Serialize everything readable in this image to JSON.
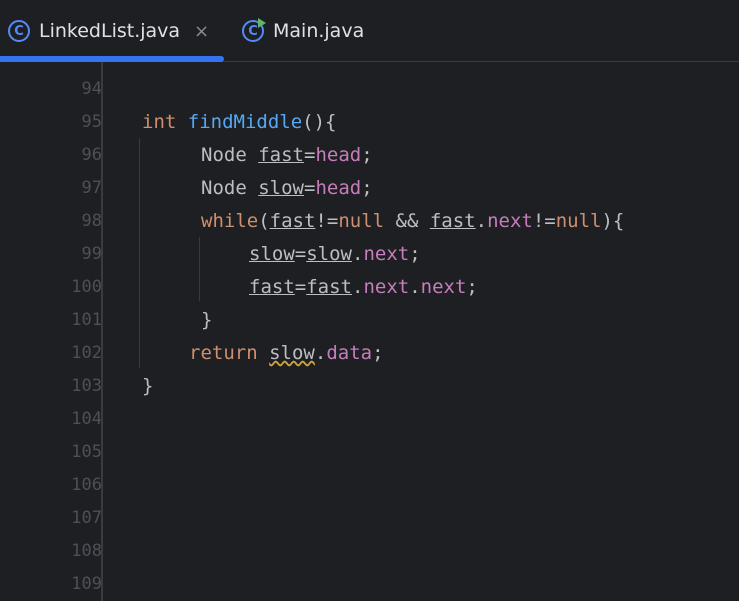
{
  "tabs": [
    {
      "label": "LinkedList.java",
      "icon": "class-icon",
      "icon_glyph": "C",
      "active": true,
      "close": "×"
    },
    {
      "label": "Main.java",
      "icon": "main-class-icon",
      "icon_glyph": "C",
      "active": false
    }
  ],
  "colors": {
    "background": "#1e1f22",
    "accent": "#3574f0",
    "keyword": "#cf8e6d",
    "function": "#56a8f5",
    "field": "#c77dbb",
    "text": "#bcbec4",
    "line_number": "#4b5059",
    "warning": "#d1a23c"
  },
  "editor": {
    "line_numbers": [
      "94",
      "95",
      "96",
      "97",
      "98",
      "99",
      "100",
      "101",
      "102",
      "103",
      "104",
      "105",
      "106",
      "107",
      "108",
      "109"
    ],
    "code": {
      "l95": {
        "kw": "int",
        "fn": "findMiddle",
        "rest": "(){"
      },
      "l96": {
        "type": "Node",
        "var": "fast",
        "eq": "=",
        "field": "head",
        "semi": ";"
      },
      "l97": {
        "type": "Node",
        "var": "slow",
        "eq": "=",
        "field": "head",
        "semi": ";"
      },
      "l98": {
        "kw": "while",
        "open": "(",
        "var1": "fast",
        "op1": "!=",
        "null1": "null",
        "and": " && ",
        "var2": "fast",
        "dot": ".",
        "field": "next",
        "op2": "!=",
        "null2": "null",
        "close": "){"
      },
      "l99": {
        "var1": "slow",
        "eq": "=",
        "var2": "slow",
        "dot": ".",
        "field": "next",
        "semi": ";"
      },
      "l100": {
        "var1": "fast",
        "eq": "=",
        "var2": "fast",
        "dot1": ".",
        "field1": "next",
        "dot2": ".",
        "field2": "next",
        "semi": ";"
      },
      "l101": {
        "brace": "}"
      },
      "l102": {
        "kw": "return",
        "var": "slow",
        "dot": ".",
        "field": "data",
        "semi": ";"
      },
      "l103": {
        "brace": "}"
      }
    }
  }
}
